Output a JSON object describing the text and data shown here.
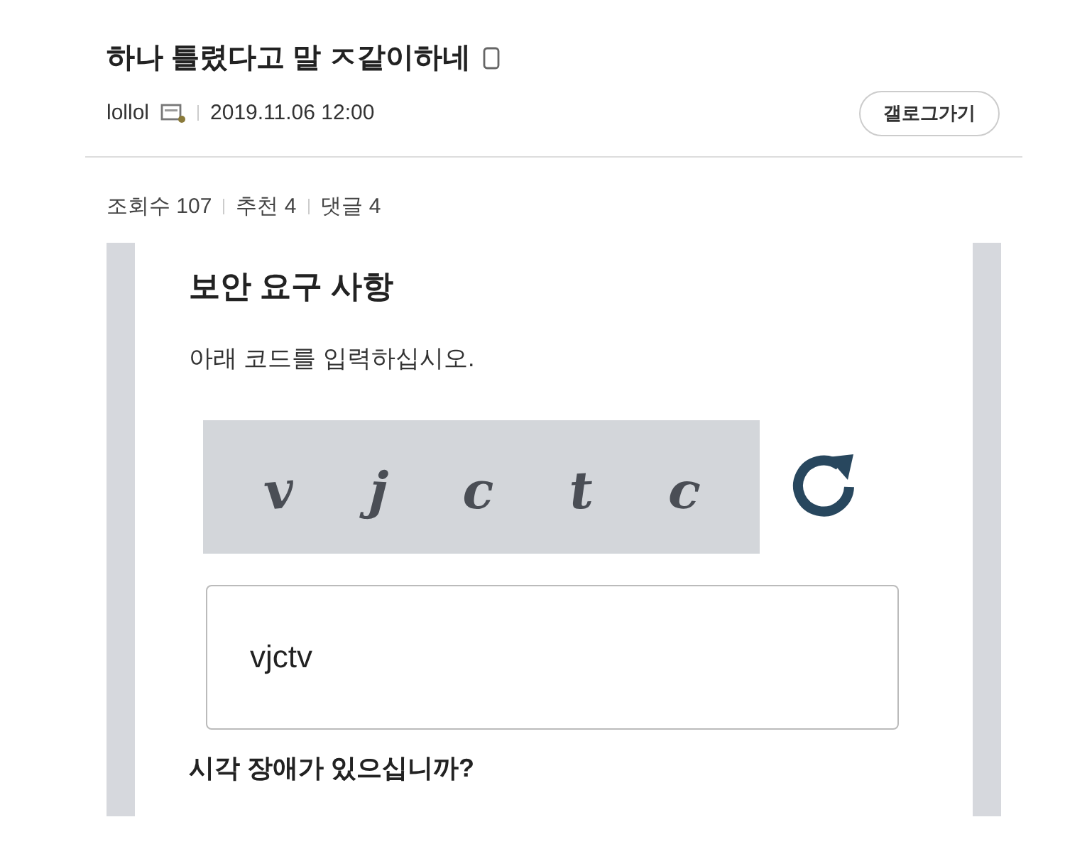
{
  "post": {
    "title": "하나 틀렸다고 말 ㅈ같이하네",
    "author": "lollol",
    "date": "2019.11.06 12:00",
    "gallery_button": "갤로그가기"
  },
  "stats": [
    {
      "label": "조회수 107"
    },
    {
      "label": "추천 4"
    },
    {
      "label": "댓글 4"
    }
  ],
  "embedded": {
    "heading": "보안 요구 사항",
    "instruction": "아래 코드를 입력하십시오.",
    "captcha": [
      "v",
      "j",
      "c",
      "t",
      "c"
    ],
    "input": {
      "value": "vjctv"
    },
    "question": "시각 장애가 있으십니까?"
  }
}
